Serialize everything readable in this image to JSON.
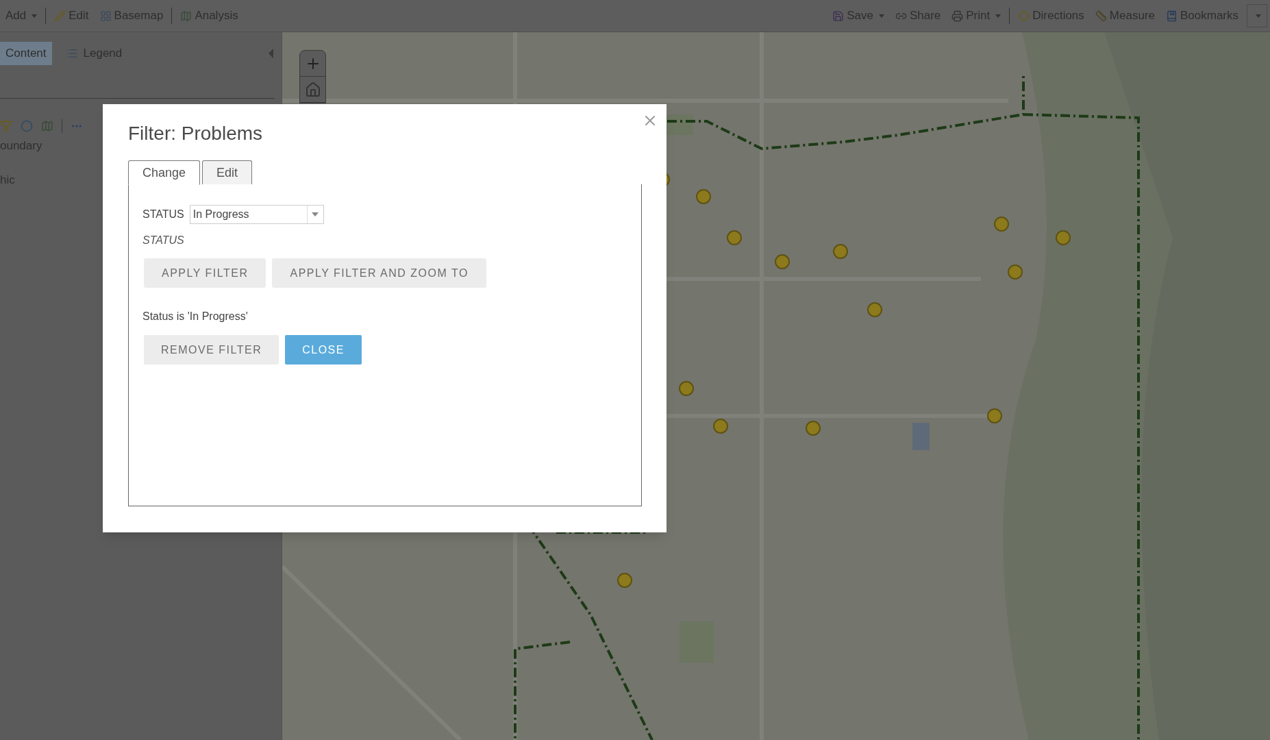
{
  "toolbar": {
    "left": [
      {
        "label": "Add",
        "kind": "menu",
        "separator_after": true
      },
      {
        "label": "Edit",
        "kind": "button",
        "separator_after": false
      },
      {
        "label": "Basemap",
        "kind": "button",
        "separator_after": true
      },
      {
        "label": "Analysis",
        "kind": "button",
        "separator_after": false
      }
    ],
    "right": [
      {
        "label": "Save",
        "kind": "menu",
        "separator_after": false
      },
      {
        "label": "Share",
        "kind": "button",
        "separator_after": false
      },
      {
        "label": "Print",
        "kind": "menu",
        "separator_after": true
      },
      {
        "label": "Directions",
        "kind": "button",
        "separator_after": false
      },
      {
        "label": "Measure",
        "kind": "button",
        "separator_after": false
      },
      {
        "label": "Bookmarks",
        "kind": "button",
        "separator_after": false
      }
    ]
  },
  "sidebar": {
    "tabs": [
      {
        "label": "Content",
        "selected": true
      },
      {
        "label": "Legend",
        "selected": false
      }
    ],
    "layers": [
      "oundary",
      "hic"
    ]
  },
  "dialog": {
    "title": "Filter: Problems",
    "tabs": [
      {
        "label": "Change",
        "selected": true
      },
      {
        "label": "Edit",
        "selected": false
      }
    ],
    "field": {
      "label": "STATUS",
      "value": "In Progress",
      "hint": "STATUS"
    },
    "filter_buttons": [
      {
        "label": "APPLY FILTER",
        "kind": "secondary"
      },
      {
        "label": "APPLY FILTER AND ZOOM TO",
        "kind": "secondary"
      }
    ],
    "summary": "Status is 'In Progress'",
    "action_buttons": [
      {
        "label": "REMOVE FILTER",
        "kind": "secondary"
      },
      {
        "label": "CLOSE",
        "kind": "primary"
      }
    ]
  }
}
